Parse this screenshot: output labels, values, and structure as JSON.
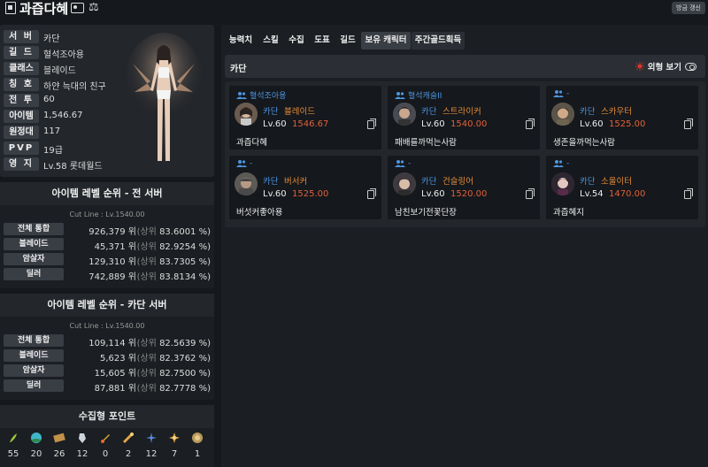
{
  "header": {
    "title": "과즙다혜",
    "refresh_label": "방금 갱신"
  },
  "profile": {
    "rows": [
      {
        "label": "서 버",
        "value": "카단"
      },
      {
        "label": "길 드",
        "value": "혈석조아용"
      },
      {
        "label": "클래스",
        "value": "블레이드"
      },
      {
        "label": "칭 호",
        "value": "하얀 늑대의 친구"
      },
      {
        "label": "전 투",
        "value": "60"
      },
      {
        "label": "아이템",
        "value": "1,546.67"
      },
      {
        "label": "원정대",
        "value": "117"
      },
      {
        "label": "PVP",
        "value": "19급"
      },
      {
        "label": "영 지",
        "value": "Lv.58 롯데월드"
      }
    ]
  },
  "rank_all": {
    "title": "아이템 레벨 순위 - 전 서버",
    "cutline": "Cut Line : Lv.1540.00",
    "rows": [
      {
        "label": "전체 통합",
        "rank": "926,379 위",
        "pct_prefix": "(상위",
        "pct": "83.6001 %)"
      },
      {
        "label": "블레이드",
        "rank": "45,371 위",
        "pct_prefix": "(상위",
        "pct": "82.9254 %)"
      },
      {
        "label": "암살자",
        "rank": "129,310 위",
        "pct_prefix": "(상위",
        "pct": "83.7305 %)"
      },
      {
        "label": "딜러",
        "rank": "742,889 위",
        "pct_prefix": "(상위",
        "pct": "83.8134 %)"
      }
    ]
  },
  "rank_server": {
    "title": "아이템 레벨 순위 - 카단 서버",
    "cutline": "Cut Line : Lv.1540.00",
    "rows": [
      {
        "label": "전체 통합",
        "rank": "109,114 위",
        "pct_prefix": "(상위",
        "pct": "82.5639 %)"
      },
      {
        "label": "블레이드",
        "rank": "5,623 위",
        "pct_prefix": "(상위",
        "pct": "82.3762 %)"
      },
      {
        "label": "암살자",
        "rank": "15,605 위",
        "pct_prefix": "(상위",
        "pct": "82.7500 %)"
      },
      {
        "label": "딜러",
        "rank": "87,881 위",
        "pct_prefix": "(상위",
        "pct": "82.7778 %)"
      }
    ]
  },
  "collectibles": {
    "title": "수집형 포인트",
    "items": [
      {
        "icon": "mokoko-seed-icon",
        "value": "55"
      },
      {
        "icon": "island-heart-icon",
        "value": "20"
      },
      {
        "icon": "great-art-icon",
        "value": "26"
      },
      {
        "icon": "giant-heart-icon",
        "value": "12"
      },
      {
        "icon": "ignea-token-icon",
        "value": "0"
      },
      {
        "icon": "orpheus-star-icon",
        "value": "2"
      },
      {
        "icon": "worldtree-leaf-icon",
        "value": "12"
      },
      {
        "icon": "omnium-star-icon",
        "value": "7"
      },
      {
        "icon": "sea-bounty-icon",
        "value": "1"
      }
    ]
  },
  "tabs": [
    "능력치",
    "스킬",
    "수집",
    "도표",
    "길드",
    "보유 캐릭터",
    "주간골드획득"
  ],
  "active_tab": "보유 캐릭터",
  "server_bar": {
    "server": "카단",
    "view_label": "외형 보기"
  },
  "characters": [
    {
      "guild": "혈석조아용",
      "server": "카단",
      "class": "블레이드",
      "level": "Lv.60",
      "ilvl": "1546.67",
      "name": "과즙다혜"
    },
    {
      "guild": "혈석캐슬II",
      "server": "카단",
      "class": "스트라이커",
      "level": "Lv.60",
      "ilvl": "1540.00",
      "name": "패배를까먹는사람"
    },
    {
      "guild": "-",
      "server": "카단",
      "class": "스카우터",
      "level": "Lv.60",
      "ilvl": "1525.00",
      "name": "생존을까먹는사람"
    },
    {
      "guild": "-",
      "server": "카단",
      "class": "버서커",
      "level": "Lv.60",
      "ilvl": "1525.00",
      "name": "버섯커좋아용"
    },
    {
      "guild": "-",
      "server": "카단",
      "class": "건슬링어",
      "level": "Lv.60",
      "ilvl": "1520.00",
      "name": "남친보기전꽃단장"
    },
    {
      "guild": "-",
      "server": "카단",
      "class": "소울이터",
      "level": "Lv.54",
      "ilvl": "1470.00",
      "name": "과즙혜지"
    }
  ],
  "colors": {
    "server_blue": "#4d95e0",
    "class_orange": "#e38b3a",
    "ilvl_red": "#e0613b",
    "sun_red": "#e0362c"
  }
}
